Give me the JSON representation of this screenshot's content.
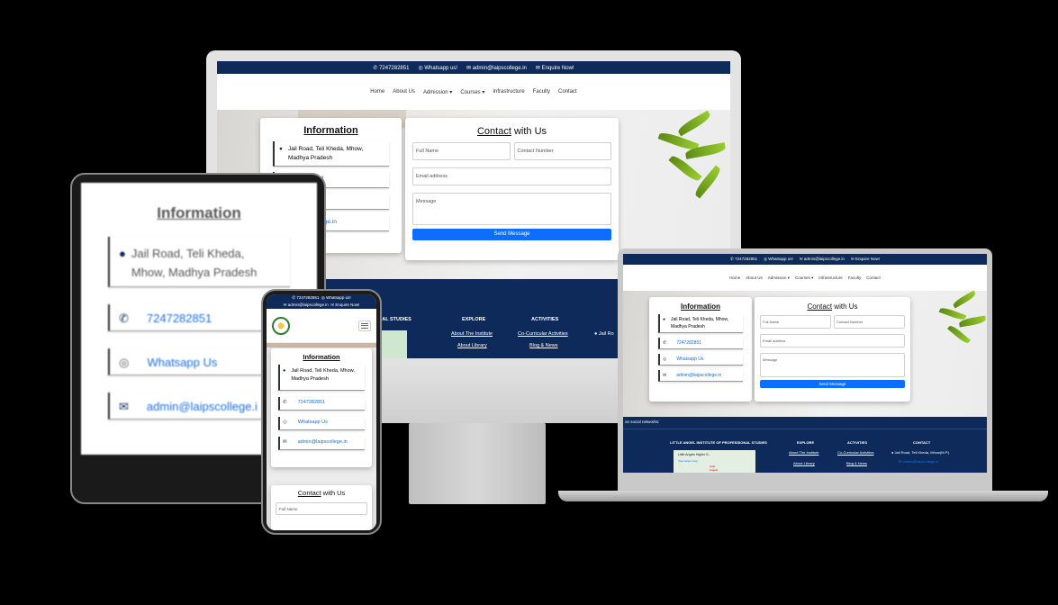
{
  "topbar": {
    "phone": "7247282851",
    "whatsapp": "Whatsapp us!",
    "email": "admin@laipscollege.in",
    "enquire": "Enquire Now!"
  },
  "nav": {
    "home": "Home",
    "about": "About Us",
    "admission": "Admission ▾",
    "courses": "Courses ▾",
    "infrastructure": "Infrastructure",
    "faculty": "Faculty",
    "contact": "Contact"
  },
  "info": {
    "title": "Information",
    "address": "Jail Road, Teli Kheda, Mhow, Madhya Pradesh",
    "address_line1": "Jail Road, Teli Kheda, Mhow,",
    "address_line2": "Madhya Pradesh",
    "tablet_address_line1": "Jail Road, Teli Kheda,",
    "tablet_address_line2": "Mhow, Madhya Pradesh",
    "phone": "7247282851",
    "whatsapp": "Whatsapp Us",
    "email": "admin@laipscollege.in",
    "phone_partial": "51",
    "whatsapp_partial": "Us",
    "email_partial": "laipscollege.in",
    "tablet_email": "admin@laipscollege.i"
  },
  "contact": {
    "title_underlined": "Contact",
    "title_rest": " with Us",
    "full_name": "Full Name",
    "contact_number": "Contact Number",
    "email": "Email address",
    "message": "Message",
    "send": "Send Message"
  },
  "footer": {
    "studies_partial": "ONAL STUDIES",
    "institute": "LITTLE ANGEL INSTITUTE OF PROFESSIONAL STUDIES",
    "explore": "EXPLORE",
    "activities": "ACTIVITIES",
    "contact": "CONTACT",
    "about_institute": "About The Institute",
    "about_library": "About Library",
    "co_curricular": "Co-Curricular Activities",
    "blog_news": "Blog & News",
    "address_short": "Jail Ro",
    "address_full": "Jail Road, Teli Kheda, Mhow(M.P.)",
    "social": "on social networks:",
    "map_label": "Little Angels Higher S...",
    "map_link": "View larger map",
    "map_pin": "Little Angels Higher..."
  },
  "colors": {
    "navy": "#0d2a5a",
    "button": "#0d6efd",
    "link": "#1a6ee0"
  }
}
